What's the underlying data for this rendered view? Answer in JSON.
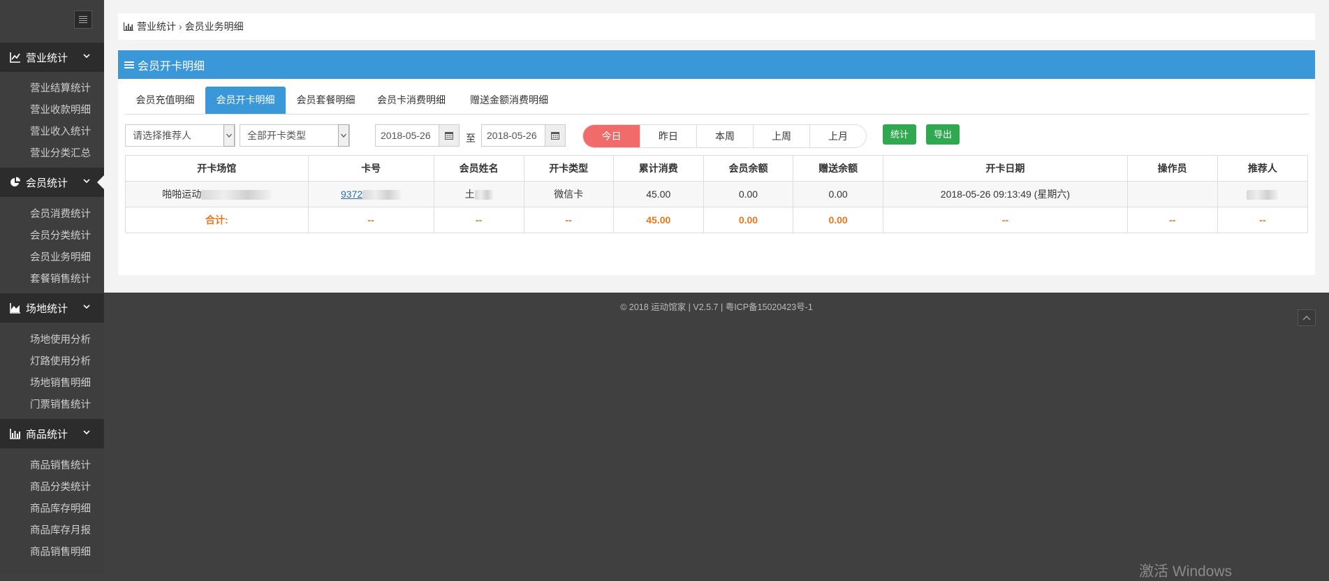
{
  "sidebar": {
    "groups": [
      {
        "label": "营业统计",
        "icon": "line-chart-icon",
        "items": [
          "营业结算统计",
          "营业收款明细",
          "营业收入统计",
          "营业分类汇总"
        ]
      },
      {
        "label": "会员统计",
        "icon": "pie-chart-icon",
        "items": [
          "会员消费统计",
          "会员分类统计",
          "会员业务明细",
          "套餐销售统计"
        ]
      },
      {
        "label": "场地统计",
        "icon": "area-chart-icon",
        "items": [
          "场地使用分析",
          "灯路使用分析",
          "场地销售明细",
          "门票销售统计"
        ]
      },
      {
        "label": "商品统计",
        "icon": "bar-chart-icon",
        "items": [
          "商品销售统计",
          "商品分类统计",
          "商品库存明细",
          "商品库存月报",
          "商品销售明细"
        ]
      }
    ]
  },
  "breadcrumb": {
    "parent": "营业统计",
    "separator": "›",
    "current": "会员业务明细"
  },
  "panel": {
    "title": "会员开卡明细"
  },
  "tabs": [
    "会员充值明细",
    "会员开卡明细",
    "会员套餐明细",
    "会员卡消费明细",
    "赠送金额消费明细"
  ],
  "filters": {
    "referrer": "请选择推荐人",
    "card_type": "全部开卡类型",
    "date_from": "2018-05-26",
    "to_label": "至",
    "date_to": "2018-05-26",
    "quick": [
      "今日",
      "昨日",
      "本周",
      "上周",
      "上月"
    ],
    "stat_button": "统计",
    "export_button": "导出"
  },
  "table": {
    "headers": [
      "开卡场馆",
      "卡号",
      "会员姓名",
      "开卡类型",
      "累计消费",
      "会员余额",
      "赠送余额",
      "开卡日期",
      "操作员",
      "推荐人"
    ],
    "row": {
      "venue": "啪啪运动",
      "card_no": "9372",
      "name": "土",
      "card_type": "微信卡",
      "total_spend": "45.00",
      "balance": "0.00",
      "gift_balance": "0.00",
      "open_date": "2018-05-26 09:13:49 (星期六)",
      "operator": "",
      "referrer": ""
    },
    "total": {
      "label": "合计:",
      "card_no": "--",
      "name": "--",
      "card_type": "--",
      "total_spend": "45.00",
      "balance": "0.00",
      "gift_balance": "0.00",
      "open_date": "--",
      "operator": "--",
      "referrer": "--"
    }
  },
  "footer": {
    "text": "© 2018 运动馆家 | V2.5.7 | 粤ICP备15020423号-1"
  },
  "watermark": "激活 Windows",
  "colors": {
    "accent": "#3a98d8",
    "today": "#f26b6b",
    "green": "#2fa84f",
    "total": "#e8761e"
  }
}
